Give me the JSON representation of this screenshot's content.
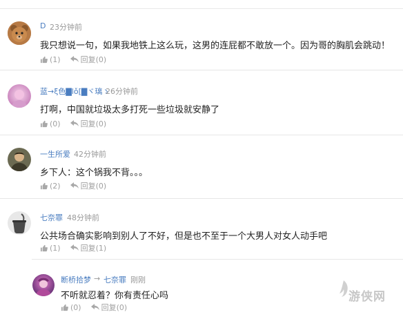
{
  "comments": [
    {
      "username": "D",
      "time": "23分钟前",
      "text": "我只想说一句，如果我地铁上这么玩，这男的连屁都不敢放一个。因为哥的胸肌会跳动！",
      "like_count": "(1)",
      "reply_label": "回复(0)",
      "avatar_icon": "bear-avatar"
    },
    {
      "username": "蓝→ξ色▇lǒ[▇ヾ璃ゝ",
      "time": "26分钟前",
      "text": "打啊，中国就垃圾太多打死一些垃圾就安静了",
      "like_count": "(0)",
      "reply_label": "回复(0)",
      "avatar_icon": "pink-avatar"
    },
    {
      "username": "一生所爱",
      "time": "42分钟前",
      "text": "乡下人：这个锅我不背。。。",
      "like_count": "(2)",
      "reply_label": "回复(0)",
      "avatar_icon": "person-avatar"
    },
    {
      "username": "七奈罪",
      "time": "48分钟前",
      "text": "公共场合确实影响到别人了不好，但是也不至于一个大男人对女人动手吧",
      "like_count": "(1)",
      "reply_label": "回复(1)",
      "avatar_icon": "pot-avatar"
    }
  ],
  "reply": {
    "username": "断桥拾梦",
    "arrow": "→",
    "reply_to": "七奈罪",
    "time": "刚刚",
    "text": "不听就忍着？你有责任心吗",
    "like_count": "(0)",
    "reply_label": "回复(0)",
    "avatar_icon": "anime-avatar"
  },
  "watermark": {
    "text": "游侠网"
  },
  "colors": {
    "username": "#4a7dc0",
    "meta": "#999999",
    "body": "#222222"
  }
}
